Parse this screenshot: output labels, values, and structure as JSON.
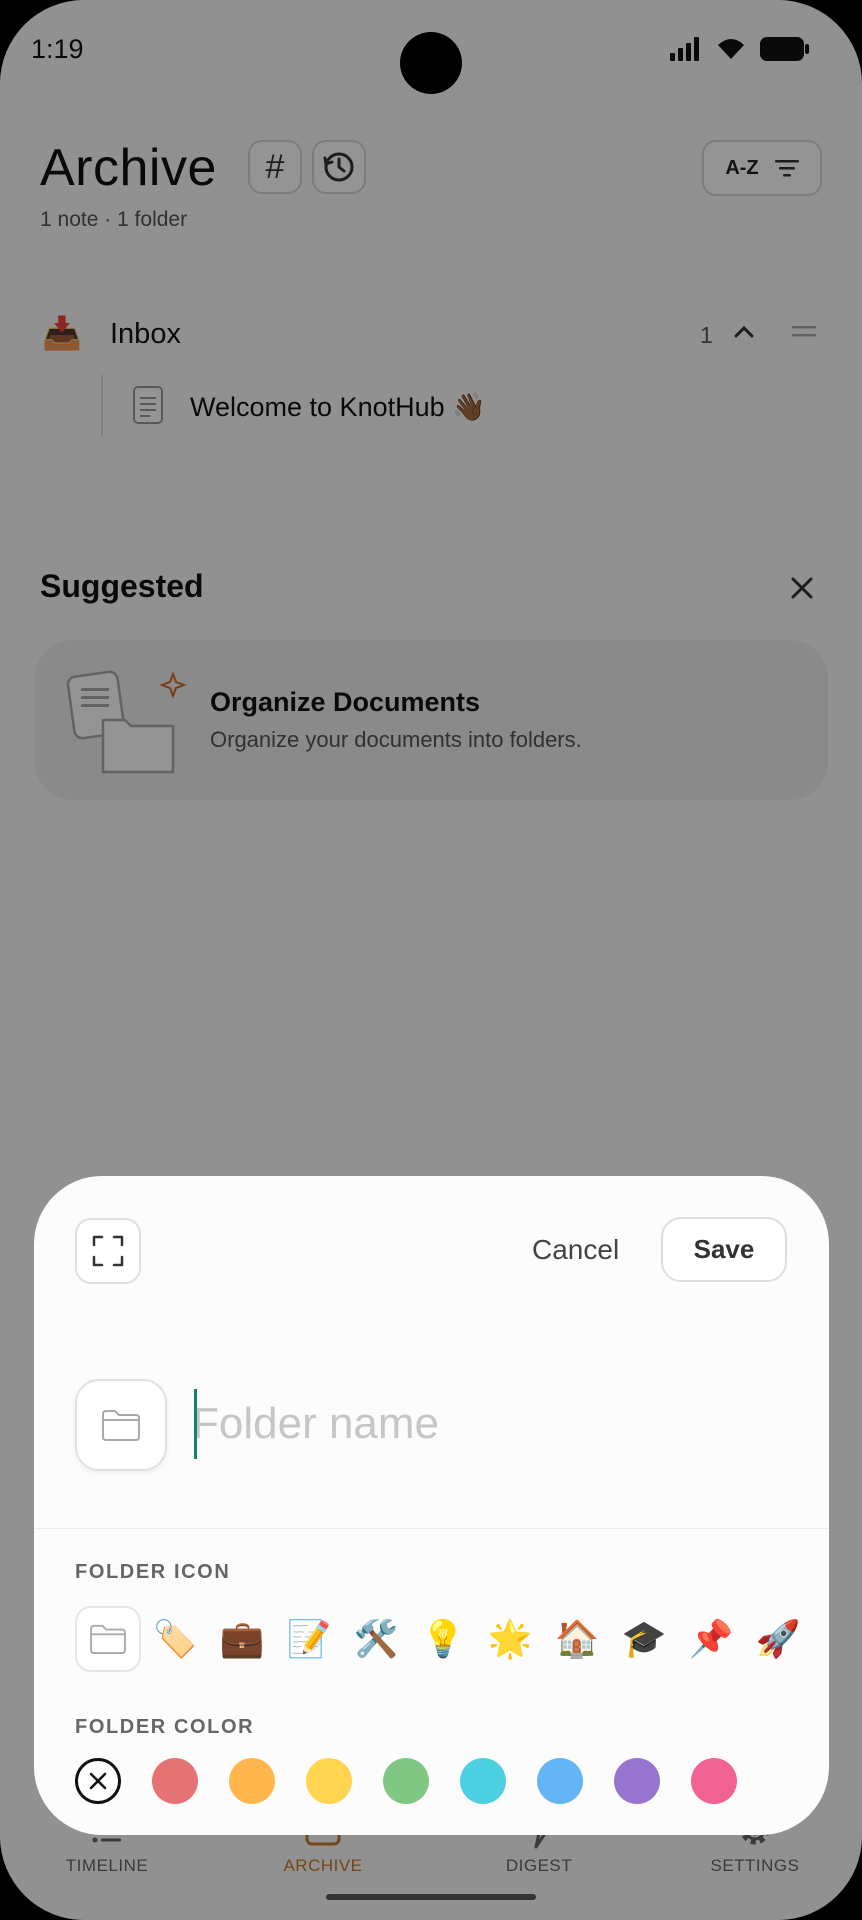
{
  "status_bar": {
    "time": "1:19"
  },
  "header": {
    "title": "Archive",
    "subtitle": "1 note · 1 folder",
    "hashtag_glyph": "#",
    "sort_label": "A-Z"
  },
  "folders": [
    {
      "icon": "📥",
      "name": "Inbox",
      "count": "1",
      "notes": [
        {
          "title": "Welcome to KnotHub 👋🏾"
        }
      ]
    }
  ],
  "suggested": {
    "title": "Suggested",
    "card": {
      "title": "Organize Documents",
      "description": "Organize your documents into folders."
    }
  },
  "tabs": [
    {
      "label": "TIMELINE",
      "icon": "list-icon",
      "active": false
    },
    {
      "label": "ARCHIVE",
      "icon": "archive-icon",
      "active": true
    },
    {
      "label": "DIGEST",
      "icon": "lightning-icon",
      "active": false
    },
    {
      "label": "SETTINGS",
      "icon": "gear-icon",
      "active": false
    }
  ],
  "sheet": {
    "cancel_label": "Cancel",
    "save_label": "Save",
    "name_placeholder": "Folder name",
    "name_value": "",
    "icon_section_label": "FOLDER ICON",
    "icon_options": [
      "folder-icon",
      "🏷️",
      "💼",
      "📝",
      "🛠️",
      "💡",
      "🌟",
      "🏠",
      "🎓",
      "📌",
      "🚀"
    ],
    "color_section_label": "FOLDER COLOR",
    "color_options": [
      "none",
      "#e57373",
      "#ffb74d",
      "#ffd54f",
      "#81c784",
      "#4dd0e1",
      "#64b5f6",
      "#9575cd",
      "#f06292"
    ]
  },
  "colors": {
    "accent": "#c77a2b",
    "caret": "#1a7d76",
    "scrim": "rgba(0,0,0,0.42)"
  }
}
